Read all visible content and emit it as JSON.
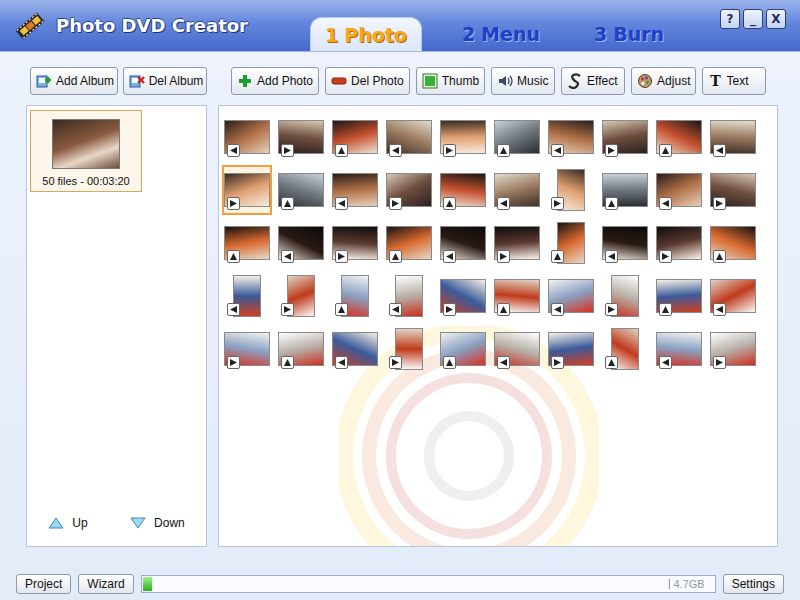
{
  "window": {
    "title": "Photo DVD Creator",
    "controls": [
      "?",
      "_",
      "X"
    ]
  },
  "steps": [
    {
      "number": "1",
      "label": "Photo",
      "selected": true
    },
    {
      "number": "2",
      "label": "Menu",
      "selected": false
    },
    {
      "number": "3",
      "label": "Burn",
      "selected": false
    }
  ],
  "album_toolbar": [
    "Add Album",
    "Del Album"
  ],
  "photo_toolbar": [
    {
      "label": "Add Photo"
    },
    {
      "label": "Del Photo"
    },
    {
      "label": "Thumb"
    },
    {
      "label": "Music"
    },
    {
      "label": "Effect"
    },
    {
      "label": "Adjust"
    },
    {
      "label": "Text",
      "glyph": "T"
    }
  ],
  "albums": [
    {
      "caption": "50 files - 00:03:20",
      "selected": true
    }
  ],
  "order_buttons": [
    "Up",
    "Down"
  ],
  "photos": [
    {
      "kind": "landscape",
      "selected": false
    },
    {
      "kind": "landscape",
      "selected": false
    },
    {
      "kind": "landscape",
      "selected": false
    },
    {
      "kind": "landscape",
      "selected": false
    },
    {
      "kind": "landscape",
      "selected": false
    },
    {
      "kind": "landscape",
      "selected": false
    },
    {
      "kind": "landscape",
      "selected": false
    },
    {
      "kind": "landscape",
      "selected": false
    },
    {
      "kind": "landscape",
      "selected": false
    },
    {
      "kind": "landscape",
      "selected": false
    },
    {
      "kind": "landscape",
      "selected": true
    },
    {
      "kind": "landscape",
      "selected": false
    },
    {
      "kind": "landscape",
      "selected": false
    },
    {
      "kind": "landscape",
      "selected": false
    },
    {
      "kind": "landscape",
      "selected": false
    },
    {
      "kind": "landscape",
      "selected": false
    },
    {
      "kind": "portrait",
      "selected": false
    },
    {
      "kind": "landscape",
      "selected": false
    },
    {
      "kind": "landscape",
      "selected": false
    },
    {
      "kind": "landscape",
      "selected": false
    },
    {
      "kind": "landscape",
      "selected": false
    },
    {
      "kind": "landscape",
      "selected": false
    },
    {
      "kind": "landscape",
      "selected": false
    },
    {
      "kind": "landscape",
      "selected": false
    },
    {
      "kind": "landscape",
      "selected": false
    },
    {
      "kind": "landscape",
      "selected": false
    },
    {
      "kind": "portrait",
      "selected": false
    },
    {
      "kind": "landscape",
      "selected": false
    },
    {
      "kind": "landscape",
      "selected": false
    },
    {
      "kind": "landscape",
      "selected": false
    },
    {
      "kind": "portrait",
      "selected": false
    },
    {
      "kind": "portrait",
      "selected": false
    },
    {
      "kind": "portrait",
      "selected": false
    },
    {
      "kind": "portrait",
      "selected": false
    },
    {
      "kind": "landscape",
      "selected": false
    },
    {
      "kind": "landscape",
      "selected": false
    },
    {
      "kind": "landscape",
      "selected": false
    },
    {
      "kind": "portrait",
      "selected": false
    },
    {
      "kind": "landscape",
      "selected": false
    },
    {
      "kind": "landscape",
      "selected": false
    },
    {
      "kind": "landscape",
      "selected": false
    },
    {
      "kind": "landscape",
      "selected": false
    },
    {
      "kind": "landscape",
      "selected": false
    },
    {
      "kind": "portrait",
      "selected": false
    },
    {
      "kind": "landscape",
      "selected": false
    },
    {
      "kind": "landscape",
      "selected": false
    },
    {
      "kind": "landscape",
      "selected": false
    },
    {
      "kind": "portrait",
      "selected": false
    },
    {
      "kind": "landscape",
      "selected": false
    },
    {
      "kind": "landscape",
      "selected": false
    }
  ],
  "footer": {
    "left_buttons": [
      "Project",
      "Wizard"
    ],
    "disc": {
      "level": 0.02,
      "capacity": "4.7GB"
    },
    "settings": "Settings"
  }
}
